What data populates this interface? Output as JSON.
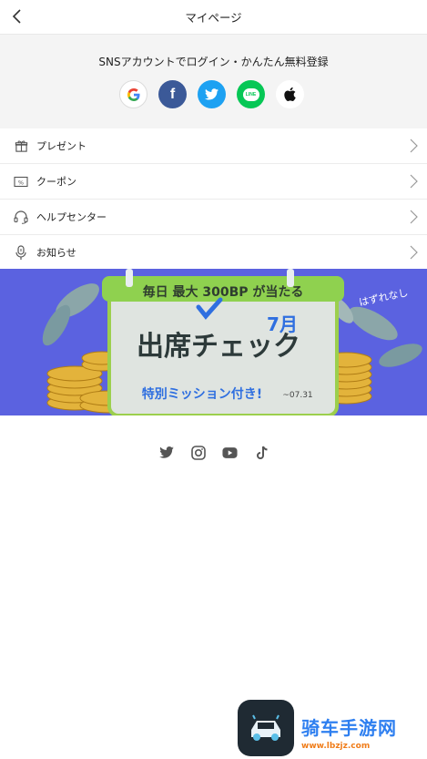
{
  "header": {
    "title": "マイページ"
  },
  "sns": {
    "title": "SNSアカウントでログイン・かんたん無料登録",
    "providers": [
      {
        "name": "google-icon",
        "glyph": "G"
      },
      {
        "name": "facebook-icon",
        "glyph": "f"
      },
      {
        "name": "twitter-icon",
        "glyph": ""
      },
      {
        "name": "line-icon",
        "glyph": "LINE"
      },
      {
        "name": "apple-icon",
        "glyph": ""
      }
    ]
  },
  "menu": {
    "items": [
      {
        "label": "プレゼント"
      },
      {
        "label": "クーポン"
      },
      {
        "label": "ヘルプセンター"
      },
      {
        "label": "お知らせ"
      }
    ]
  },
  "banner": {
    "top_text": "毎日 最大 300BP が当たる",
    "main_text": "出席チェック",
    "month": "7月",
    "sub_text": "特別ミッション付き!",
    "date": "~07.31",
    "tag": "はずれなし",
    "background": "#5b62e0"
  },
  "social": [
    "twitter-icon",
    "instagram-icon",
    "youtube-icon",
    "tiktok-icon"
  ],
  "watermark": {
    "title": "骑车手游网",
    "url": "www.lbzjz.com"
  }
}
